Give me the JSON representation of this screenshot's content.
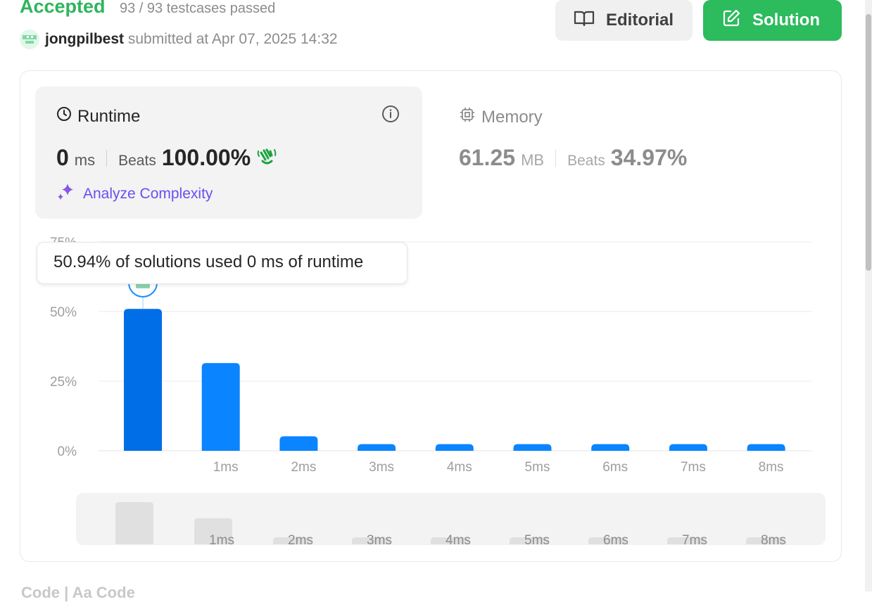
{
  "header": {
    "status": "Accepted",
    "testcases": "93 / 93 testcases passed",
    "username": "jongpilbest",
    "submitted_text": "submitted at Apr 07, 2025 14:32"
  },
  "buttons": {
    "editorial": "Editorial",
    "solution": "Solution"
  },
  "runtime": {
    "title": "Runtime",
    "value": "0",
    "unit": "ms",
    "beats_label": "Beats",
    "beats_value": "100.00%",
    "analyze_label": "Analyze Complexity"
  },
  "memory": {
    "title": "Memory",
    "value": "61.25",
    "unit": "MB",
    "beats_label": "Beats",
    "beats_value": "34.97%"
  },
  "tooltip": "50.94% of solutions used 0 ms of runtime",
  "below_text": "Code | Aa Code",
  "colors": {
    "accepted": "#2db55d",
    "solution_button": "#2cbb5d",
    "bar": "#0a84ff",
    "bar_selected": "#006ee6",
    "analyze": "#6c4ef2",
    "overview_bar": "#e0e0e0"
  },
  "icons": {
    "editorial": "book-open-icon",
    "solution": "edit-icon",
    "runtime": "clock-icon",
    "info": "info-icon",
    "memory": "chip-icon",
    "beats": "clap-icon",
    "analyze": "sparkle-icon"
  },
  "chart_data": {
    "type": "bar",
    "ytick_labels": [
      "0%",
      "25%",
      "50%",
      "75%"
    ],
    "ylim": [
      0,
      75
    ],
    "grid": true,
    "categories": [
      "0ms",
      "1ms",
      "2ms",
      "3ms",
      "4ms",
      "5ms",
      "6ms",
      "7ms",
      "8ms"
    ],
    "xtick_labels": [
      "",
      "1ms",
      "2ms",
      "3ms",
      "4ms",
      "5ms",
      "6ms",
      "7ms",
      "8ms"
    ],
    "values": [
      50.94,
      31.5,
      5.2,
      2.4,
      2.4,
      2.4,
      2.4,
      2.4,
      2.4
    ],
    "selected_index": 0
  }
}
